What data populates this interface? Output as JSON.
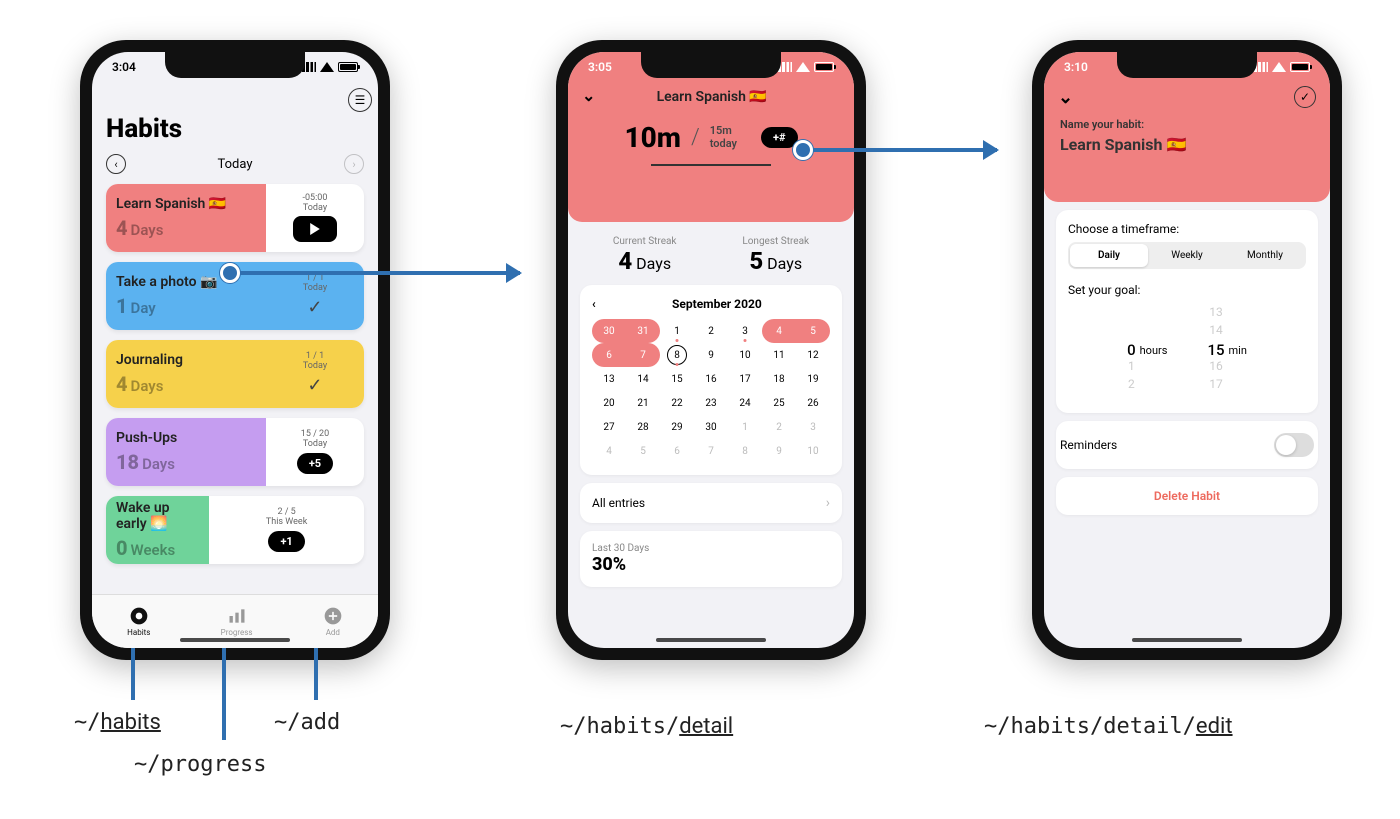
{
  "routes": {
    "habits": "~/habits",
    "progress": "~/progress",
    "add": "~/add",
    "detail": "~/habits/detail",
    "edit": "~/habits/detail/edit"
  },
  "screen1": {
    "time": "3:04",
    "title": "Habits",
    "date_label": "Today",
    "habits": [
      {
        "name": "Learn Spanish 🇪🇸",
        "count": "4",
        "unit": "Days",
        "meta1": "-05:00",
        "meta2": "Today",
        "action": "play"
      },
      {
        "name": "Take a photo 📷",
        "count": "1",
        "unit": "Day",
        "meta1": "1 / 1",
        "meta2": "Today",
        "action": "check"
      },
      {
        "name": "Journaling",
        "count": "4",
        "unit": "Days",
        "meta1": "1 / 1",
        "meta2": "Today",
        "action": "check"
      },
      {
        "name": "Push-Ups",
        "count": "18",
        "unit": "Days",
        "meta1": "15 / 20",
        "meta2": "Today",
        "action": "+5"
      },
      {
        "name": "Wake up early 🌅",
        "count": "0",
        "unit": "Weeks",
        "meta1": "2 / 5",
        "meta2": "This Week",
        "action": "+1"
      }
    ],
    "tabs": [
      {
        "label": "Habits"
      },
      {
        "label": "Progress"
      },
      {
        "label": "Add"
      }
    ]
  },
  "screen2": {
    "time": "3:05",
    "title": "Learn Spanish 🇪🇸",
    "big": "10m",
    "goal_top": "15m",
    "goal_bottom": "today",
    "chip": "+#",
    "current_label": "Current Streak",
    "current_val": "4",
    "current_unit": "Days",
    "longest_label": "Longest Streak",
    "longest_val": "5",
    "longest_unit": "Days",
    "cal_month": "September 2020",
    "cal": [
      [
        "30",
        "31",
        "1",
        "2",
        "3",
        "4",
        "5"
      ],
      [
        "6",
        "7",
        "8",
        "9",
        "10",
        "11",
        "12"
      ],
      [
        "13",
        "14",
        "15",
        "16",
        "17",
        "18",
        "19"
      ],
      [
        "20",
        "21",
        "22",
        "23",
        "24",
        "25",
        "26"
      ],
      [
        "27",
        "28",
        "29",
        "30",
        "1",
        "2",
        "3"
      ],
      [
        "4",
        "5",
        "6",
        "7",
        "8",
        "9",
        "10"
      ]
    ],
    "all_entries": "All entries",
    "last30_label": "Last 30 Days",
    "last30_val": "30%"
  },
  "screen3": {
    "time": "3:10",
    "name_label": "Name your habit:",
    "name_value": "Learn Spanish 🇪🇸",
    "timeframe_label": "Choose a timeframe:",
    "timeframe": [
      "Daily",
      "Weekly",
      "Monthly"
    ],
    "goal_label": "Set your goal:",
    "hours": [
      "",
      "",
      "0",
      "1",
      "2"
    ],
    "mins": [
      "13",
      "14",
      "15",
      "16",
      "17"
    ],
    "hours_unit": "hours",
    "mins_unit": "min",
    "reminders": "Reminders",
    "delete": "Delete Habit"
  }
}
